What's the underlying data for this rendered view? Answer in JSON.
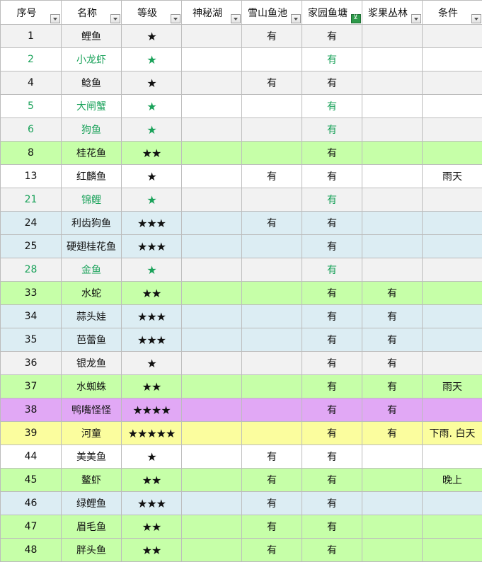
{
  "headers": [
    "序号",
    "名称",
    "等级",
    "神秘湖",
    "雪山鱼池",
    "家园鱼塘",
    "浆果丛林",
    "条件"
  ],
  "filter_active_column": 5,
  "colors": {
    "gray": "#f2f2f2",
    "white": "#ffffff",
    "green": "#c6ffa8",
    "blue": "#dcedf3",
    "purple": "#e1a8f5",
    "yellow": "#fbfd9e",
    "green_text": "#1aa25a",
    "filter_active": "#2d9a4a"
  },
  "rows": [
    {
      "no": "1",
      "name": "鲤鱼",
      "grade": "★",
      "lake": "",
      "snow": "有",
      "home": "有",
      "berry": "",
      "cond": "",
      "bg": "gray",
      "green_text": false
    },
    {
      "no": "2",
      "name": "小龙虾",
      "grade": "★",
      "lake": "",
      "snow": "",
      "home": "有",
      "berry": "",
      "cond": "",
      "bg": "white",
      "green_text": true
    },
    {
      "no": "4",
      "name": "鲶鱼",
      "grade": "★",
      "lake": "",
      "snow": "有",
      "home": "有",
      "berry": "",
      "cond": "",
      "bg": "gray",
      "green_text": false
    },
    {
      "no": "5",
      "name": "大闸蟹",
      "grade": "★",
      "lake": "",
      "snow": "",
      "home": "有",
      "berry": "",
      "cond": "",
      "bg": "white",
      "green_text": true
    },
    {
      "no": "6",
      "name": "狗鱼",
      "grade": "★",
      "lake": "",
      "snow": "",
      "home": "有",
      "berry": "",
      "cond": "",
      "bg": "gray",
      "green_text": true
    },
    {
      "no": "8",
      "name": "桂花鱼",
      "grade": "★★",
      "lake": "",
      "snow": "",
      "home": "有",
      "berry": "",
      "cond": "",
      "bg": "green",
      "green_text": false
    },
    {
      "no": "13",
      "name": "红麟鱼",
      "grade": "★",
      "lake": "",
      "snow": "有",
      "home": "有",
      "berry": "",
      "cond": "雨天",
      "bg": "white",
      "green_text": false
    },
    {
      "no": "21",
      "name": "锦鲤",
      "grade": "★",
      "lake": "",
      "snow": "",
      "home": "有",
      "berry": "",
      "cond": "",
      "bg": "gray",
      "green_text": true
    },
    {
      "no": "24",
      "name": "利齿狗鱼",
      "grade": "★★★",
      "lake": "",
      "snow": "有",
      "home": "有",
      "berry": "",
      "cond": "",
      "bg": "blue",
      "green_text": false
    },
    {
      "no": "25",
      "name": "硬翅桂花鱼",
      "grade": "★★★",
      "lake": "",
      "snow": "",
      "home": "有",
      "berry": "",
      "cond": "",
      "bg": "blue",
      "green_text": false
    },
    {
      "no": "28",
      "name": "金鱼",
      "grade": "★",
      "lake": "",
      "snow": "",
      "home": "有",
      "berry": "",
      "cond": "",
      "bg": "gray",
      "green_text": true
    },
    {
      "no": "33",
      "name": "水蛇",
      "grade": "★★",
      "lake": "",
      "snow": "",
      "home": "有",
      "berry": "有",
      "cond": "",
      "bg": "green",
      "green_text": false
    },
    {
      "no": "34",
      "name": "蒜头娃",
      "grade": "★★★",
      "lake": "",
      "snow": "",
      "home": "有",
      "berry": "有",
      "cond": "",
      "bg": "blue",
      "green_text": false
    },
    {
      "no": "35",
      "name": "芭蕾鱼",
      "grade": "★★★",
      "lake": "",
      "snow": "",
      "home": "有",
      "berry": "有",
      "cond": "",
      "bg": "blue",
      "green_text": false
    },
    {
      "no": "36",
      "name": "银龙鱼",
      "grade": "★",
      "lake": "",
      "snow": "",
      "home": "有",
      "berry": "有",
      "cond": "",
      "bg": "gray",
      "green_text": false
    },
    {
      "no": "37",
      "name": "水蜘蛛",
      "grade": "★★",
      "lake": "",
      "snow": "",
      "home": "有",
      "berry": "有",
      "cond": "雨天",
      "bg": "green",
      "green_text": false
    },
    {
      "no": "38",
      "name": "鸭嘴怪怪",
      "grade": "★★★★",
      "lake": "",
      "snow": "",
      "home": "有",
      "berry": "有",
      "cond": "",
      "bg": "purple",
      "green_text": false
    },
    {
      "no": "39",
      "name": "河童",
      "grade": "★★★★★",
      "lake": "",
      "snow": "",
      "home": "有",
      "berry": "有",
      "cond": "下雨. 白天",
      "bg": "yellow",
      "green_text": false
    },
    {
      "no": "44",
      "name": "美美鱼",
      "grade": "★",
      "lake": "",
      "snow": "有",
      "home": "有",
      "berry": "",
      "cond": "",
      "bg": "white",
      "green_text": false
    },
    {
      "no": "45",
      "name": "鳌虾",
      "grade": "★★",
      "lake": "",
      "snow": "有",
      "home": "有",
      "berry": "",
      "cond": "晚上",
      "bg": "green",
      "green_text": false
    },
    {
      "no": "46",
      "name": "绿鲤鱼",
      "grade": "★★★",
      "lake": "",
      "snow": "有",
      "home": "有",
      "berry": "",
      "cond": "",
      "bg": "blue",
      "green_text": false
    },
    {
      "no": "47",
      "name": "眉毛鱼",
      "grade": "★★",
      "lake": "",
      "snow": "有",
      "home": "有",
      "berry": "",
      "cond": "",
      "bg": "green",
      "green_text": false
    },
    {
      "no": "48",
      "name": "胖头鱼",
      "grade": "★★",
      "lake": "",
      "snow": "有",
      "home": "有",
      "berry": "",
      "cond": "",
      "bg": "green",
      "green_text": false
    }
  ]
}
